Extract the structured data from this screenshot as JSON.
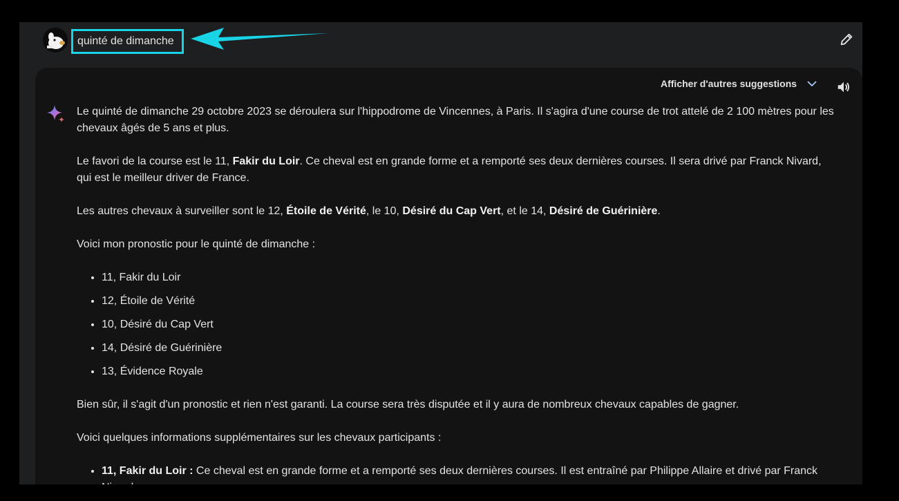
{
  "prompt": {
    "text": "quinté de dimanche"
  },
  "response": {
    "suggestions_label": "Afficher d'autres suggestions",
    "p1": "Le quinté de dimanche 29 octobre 2023 se déroulera sur l'hippodrome de Vincennes, à Paris. Il s'agira d'une course de trot attelé de 2 100 mètres pour les chevaux âgés de 5 ans et plus.",
    "p2": {
      "a": "Le favori de la course est le 11, ",
      "b": "Fakir du Loir",
      "c": ". Ce cheval est en grande forme et a remporté ses deux dernières courses. Il sera drivé par Franck Nivard, qui est le meilleur driver de France."
    },
    "p3": {
      "a": "Les autres chevaux à surveiller sont le 12, ",
      "b": "Étoile de Vérité",
      "c": ", le 10, ",
      "d": "Désiré du Cap Vert",
      "e": ", et le 14, ",
      "f": "Désiré de Guérinière",
      "g": "."
    },
    "p4": "Voici mon pronostic pour le quinté de dimanche :",
    "pronostic": [
      "11, Fakir du Loir",
      "12, Étoile de Vérité",
      "10, Désiré du Cap Vert",
      "14, Désiré de Guérinière",
      "13, Évidence Royale"
    ],
    "p5": "Bien sûr, il s'agit d'un pronostic et rien n'est garanti. La course sera très disputée et il y aura de nombreux chevaux capables de gagner.",
    "p6": "Voici quelques informations supplémentaires sur les chevaux participants :",
    "details": [
      {
        "name": "11, Fakir du Loir :",
        "text": " Ce cheval est en grande forme et a remporté ses deux dernières courses. Il est entraîné par Philippe Allaire et drivé par Franck Nivard."
      }
    ]
  },
  "icons": {
    "avatar": "avatar-icon",
    "arrow": "arrow-left-icon",
    "edit": "pencil-icon",
    "chevron": "chevron-down-icon",
    "speaker": "speaker-icon",
    "sparkle": "gemini-sparkle-icon"
  },
  "colors": {
    "highlight": "#18d4e6",
    "panel": "#131314",
    "frame": "#1e1f20"
  }
}
